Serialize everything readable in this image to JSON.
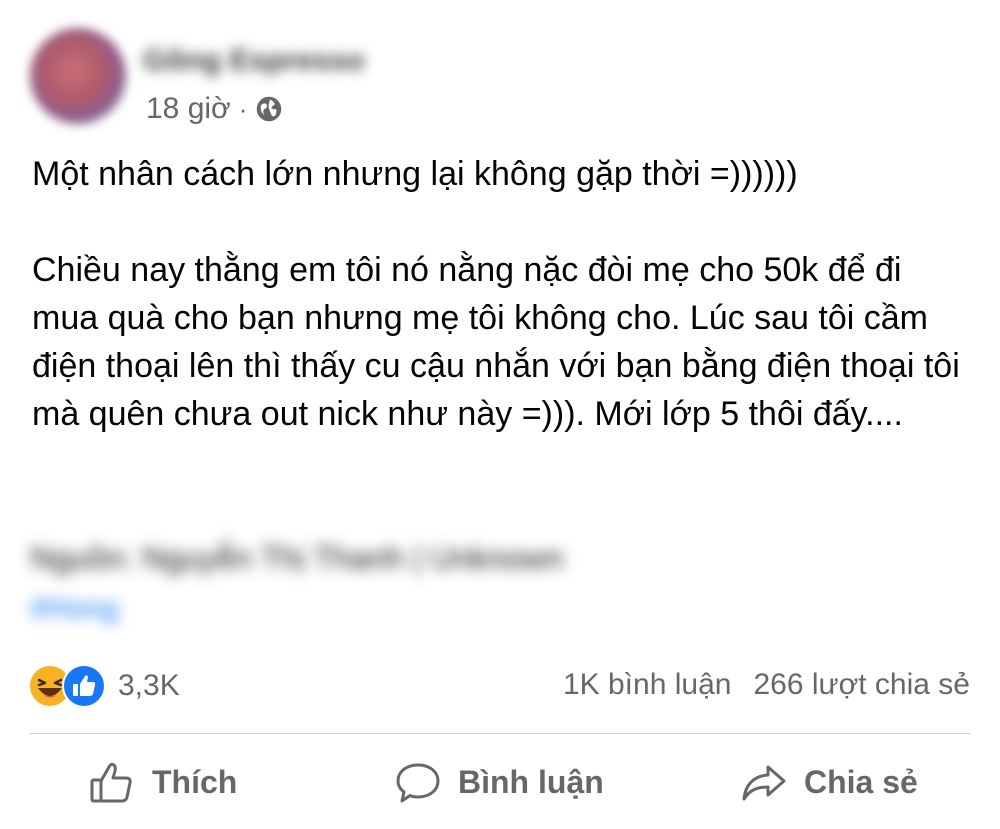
{
  "author": {
    "name": "Gõng Espresso"
  },
  "meta": {
    "time": "18 giờ",
    "separator": "·",
    "audience_icon": "globe-icon"
  },
  "content": {
    "line1": "Một nhân cách lớn nhưng lại không gặp thời =))))))",
    "paragraph2": "Chiều nay thằng em tôi nó nằng nặc đòi mẹ cho 50k để đi mua quà cho bạn nhưng mẹ tôi không cho. Lúc sau tôi cầm điện thoại lên thì thấy cu cậu nhắn với bạn bằng điện thoại tôi mà quên chưa out nick như này =))). Mới lớp 5 thôi đấy....",
    "source": "Nguồn: Nguyễn Thị Thanh | Unknown",
    "hashtag": "#Hong"
  },
  "stats": {
    "reactions_count": "3,3K",
    "reaction_icons": [
      "haha-icon",
      "like-icon"
    ],
    "comments": "1K bình luận",
    "shares": "266 lượt chia sẻ"
  },
  "actions": {
    "like_label": "Thích",
    "comment_label": "Bình luận",
    "share_label": "Chia sẻ"
  },
  "colors": {
    "text_primary": "#050505",
    "text_secondary": "#65676b",
    "like_blue": "#1877f2",
    "haha_yellow": "#f7b125",
    "divider": "#ced0d4"
  }
}
